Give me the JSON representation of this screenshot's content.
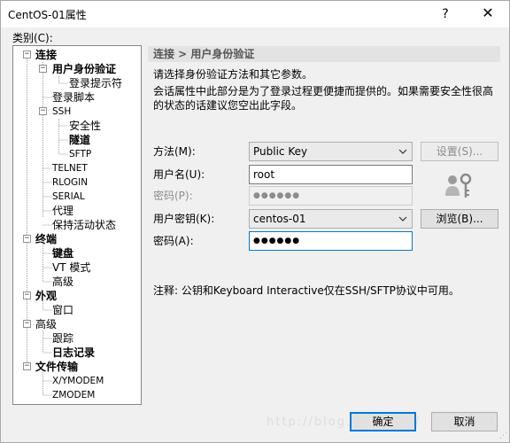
{
  "window": {
    "title": "CentOS-01属性",
    "help": "?",
    "close": "✕"
  },
  "category_label": "类别(C):",
  "tree": [
    {
      "label": "连接",
      "bold": true
    },
    {
      "label": "用户身份验证",
      "bold": true
    },
    {
      "label": "登录提示符"
    },
    {
      "label": "登录脚本"
    },
    {
      "label": "SSH"
    },
    {
      "label": "安全性"
    },
    {
      "label": "隧道",
      "bold": true
    },
    {
      "label": "SFTP"
    },
    {
      "label": "TELNET"
    },
    {
      "label": "RLOGIN"
    },
    {
      "label": "SERIAL"
    },
    {
      "label": "代理"
    },
    {
      "label": "保持活动状态"
    },
    {
      "label": "终端",
      "bold": true
    },
    {
      "label": "键盘",
      "bold": true
    },
    {
      "label": "VT 模式"
    },
    {
      "label": "高级"
    },
    {
      "label": "外观",
      "bold": true
    },
    {
      "label": "窗口"
    },
    {
      "label": "高级"
    },
    {
      "label": "跟踪"
    },
    {
      "label": "日志记录",
      "bold": true
    },
    {
      "label": "文件传输",
      "bold": true
    },
    {
      "label": "X/YMODEM"
    },
    {
      "label": "ZMODEM"
    }
  ],
  "panel": {
    "header": "连接 > 用户身份验证",
    "desc1": "请选择身份验证方法和其它参数。",
    "desc2": "会话属性中此部分是为了登录过程更便捷而提供的。如果需要安全性很高的状态的话建议您空出此字段。",
    "method_label": "方法(M):",
    "method_value": "Public Key",
    "settings_button": "设置(S)...",
    "username_label": "用户名(U):",
    "username_value": "root",
    "password_label": "密码(P):",
    "password_value": "●●●●●●",
    "user_key_label": "用户密钥(K):",
    "user_key_value": "centos-01",
    "browse_button": "浏览(B)...",
    "passphrase_label": "密码(A):",
    "passphrase_value": "●●●●●●",
    "note": "注释: 公钥和Keyboard Interactive仅在SSH/SFTP协议中可用。"
  },
  "footer": {
    "ok_button": "确定",
    "cancel_button": "取消",
    "watermark": "http://blog.csdn.net/"
  },
  "icons": {
    "tree_expanded": "minus-expander-icon",
    "dropdown": "chevron-down-icon",
    "key": "user-key-icon"
  },
  "colors": {
    "focus": "#0078d7",
    "header_bg": "#e3e3e3"
  }
}
